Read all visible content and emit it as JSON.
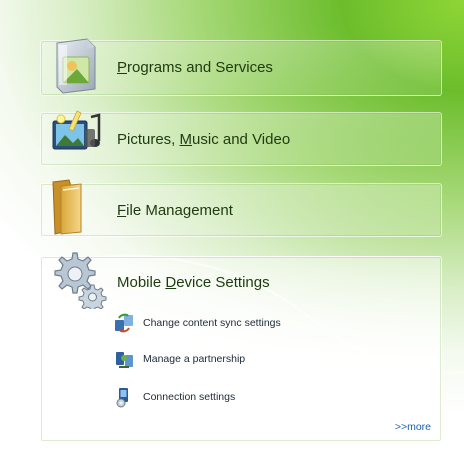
{
  "cards": [
    {
      "label_pre": "",
      "label_ul": "P",
      "label_post": "rograms and Services",
      "icon": "programs-icon"
    },
    {
      "label_pre": "Pictures, ",
      "label_ul": "M",
      "label_post": "usic and Video",
      "icon": "pictures-music-video-icon"
    },
    {
      "label_pre": "",
      "label_ul": "F",
      "label_post": "ile Management",
      "icon": "folder-icon"
    },
    {
      "label_pre": "Mobile ",
      "label_ul": "D",
      "label_post": "evice Settings",
      "icon": "gears-icon"
    }
  ],
  "mobile_links": [
    {
      "label": "Change content sync settings",
      "icon": "sync-settings-icon"
    },
    {
      "label": "Manage a partnership",
      "icon": "partnership-icon"
    },
    {
      "label": "Connection settings",
      "icon": "connection-settings-icon"
    }
  ],
  "more_link": ">>more",
  "colors": {
    "green": "#6cbd2c",
    "link_blue": "#1a5fb4",
    "title_text": "#1f3a10"
  }
}
